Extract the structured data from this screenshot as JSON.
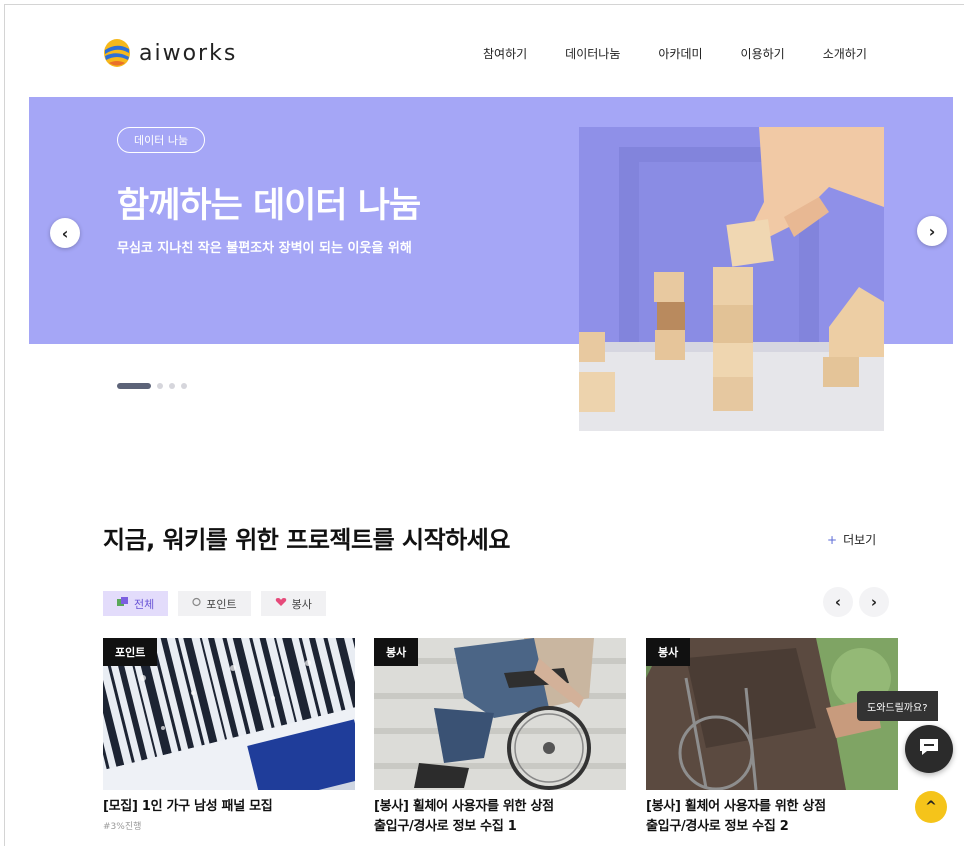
{
  "header": {
    "logo_text": "aiworks",
    "nav": [
      "참여하기",
      "데이터나눔",
      "아카데미",
      "이용하기",
      "소개하기"
    ]
  },
  "banner": {
    "chip": "데이터 나눔",
    "title": "함께하는 데이터 나눔",
    "subtitle": "무심코 지나친 작은 불편조차 장벽이 되는 이웃을 위해",
    "prev_glyph": "‹",
    "next_glyph": "›",
    "active_slide": 1,
    "slide_count": 4
  },
  "section": {
    "title": "지금, 워키를 위한 프로젝트를 시작하세요",
    "more_label": "더보기",
    "more_plus": "+",
    "filters": [
      {
        "label": "전체",
        "icon": "layers-icon",
        "active": true
      },
      {
        "label": "포인트",
        "icon": "coin-icon",
        "active": false
      },
      {
        "label": "봉사",
        "icon": "heart-hand-icon",
        "active": false
      }
    ],
    "prev_glyph": "‹",
    "next_glyph": "›"
  },
  "cards": [
    {
      "tag": "포인트",
      "title": "[모집] 1인 가구 남성 패널 모집",
      "title2": "",
      "meta": "#3%진행"
    },
    {
      "tag": "봉사",
      "title": "[봉사] 휠체어 사용자를 위한 상점",
      "title2": "출입구/경사로 정보 수집 1",
      "meta": ""
    },
    {
      "tag": "봉사",
      "title": "[봉사] 휠체어 사용자를 위한 상점",
      "title2": "출입구/경사로 정보 수집 2",
      "meta": ""
    }
  ],
  "chat": {
    "bubble": "도와드릴까요?",
    "close": "×"
  },
  "top_button_glyph": "^",
  "colors": {
    "banner_bg": "#a5a6f6",
    "accent_purple": "#6a55d6",
    "top_button": "#f5c41a"
  }
}
